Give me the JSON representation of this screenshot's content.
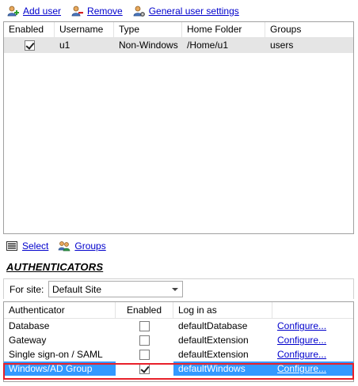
{
  "toolbar": {
    "add_user": "Add user",
    "remove": "Remove",
    "general_settings": "General user settings"
  },
  "users": {
    "columns": [
      "Enabled",
      "Username",
      "Type",
      "Home Folder",
      "Groups"
    ],
    "rows": [
      {
        "enabled": true,
        "username": "u1",
        "type": "Non-Windows",
        "home_folder": "/Home/u1",
        "groups": "users"
      }
    ]
  },
  "subtoolbar": {
    "select": "Select",
    "groups": "Groups"
  },
  "authenticators": {
    "title": "AUTHENTICATORS",
    "site_label": "For site:",
    "site_value": "Default Site",
    "columns": [
      "Authenticator",
      "Enabled",
      "Log in as"
    ],
    "rows": [
      {
        "name": "Database",
        "enabled": false,
        "login_as": "defaultDatabase",
        "action": "Configure..."
      },
      {
        "name": "Gateway",
        "enabled": false,
        "login_as": "defaultExtension",
        "action": "Configure..."
      },
      {
        "name": "Single sign-on / SAML",
        "enabled": false,
        "login_as": "defaultExtension",
        "action": "Configure..."
      },
      {
        "name": "Windows/AD Group",
        "enabled": true,
        "login_as": "defaultWindows",
        "action": "Configure...",
        "selected": true
      }
    ]
  },
  "colors": {
    "selection": "#3399ff",
    "highlight_outline": "#e8202a",
    "link": "#0000cc",
    "row_gray": "#e5e5e5"
  }
}
